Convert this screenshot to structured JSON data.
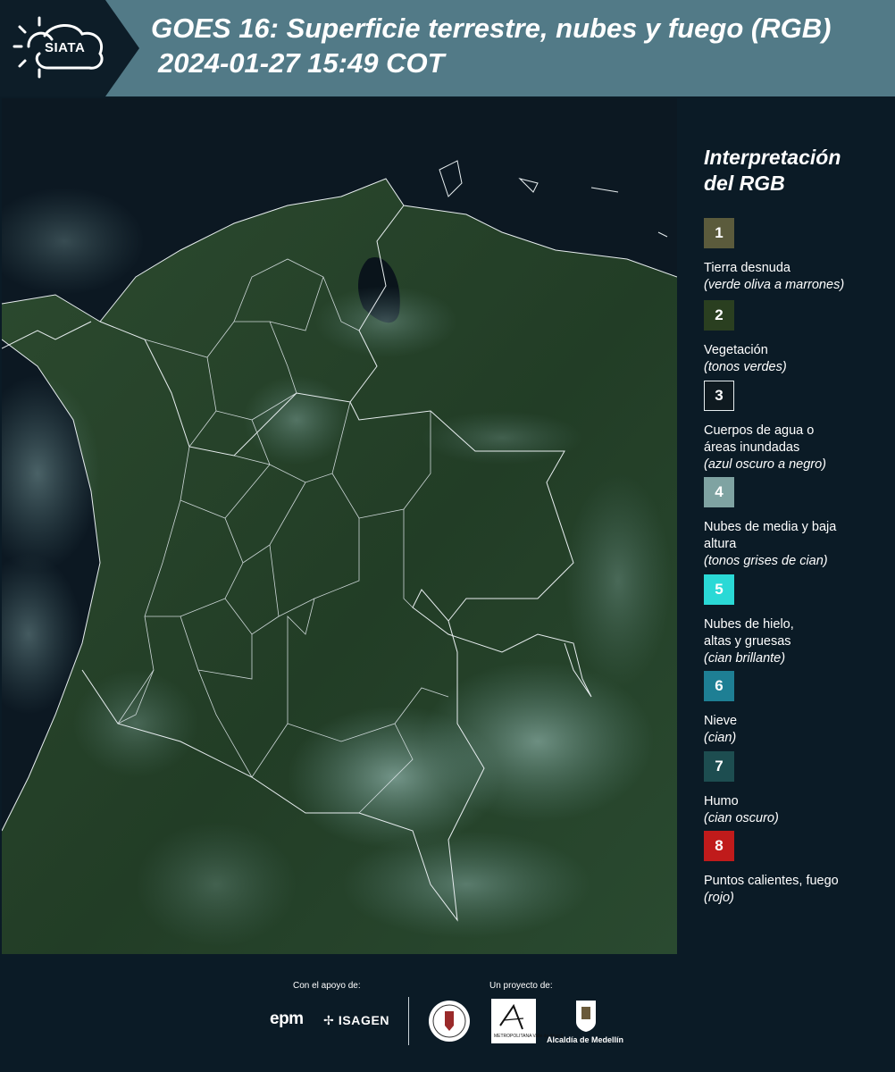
{
  "header": {
    "logo_text": "SIATA",
    "title_line1": "GOES 16: Superficie terrestre, nubes y fuego (RGB)",
    "title_line2": "2024-01-27 15:49 COT"
  },
  "legend": {
    "title_line1": "Interpretación",
    "title_line2": "del RGB",
    "items": [
      {
        "num": "1",
        "color": "#5b5b3c",
        "label": "Tierra desnuda",
        "sub": "(verde oliva a marrones)"
      },
      {
        "num": "2",
        "color": "#2a3f20",
        "label": "Vegetación",
        "sub": "(tonos verdes)"
      },
      {
        "num": "3",
        "color": "#0f1a20",
        "label": "Cuerpos de agua o áreas inundadas",
        "sub": "(azul oscuro a negro)"
      },
      {
        "num": "4",
        "color": "#7fa3a2",
        "label": "Nubes de media y baja altura",
        "sub": "(tonos grises de cian)"
      },
      {
        "num": "5",
        "color": "#2ad9d6",
        "label": "Nubes de hielo, altas y gruesas",
        "sub": "(cian brillante)"
      },
      {
        "num": "6",
        "color": "#1e7f94",
        "label": "Nieve",
        "sub": "(cian)"
      },
      {
        "num": "7",
        "color": "#1d4d50",
        "label": "Humo",
        "sub": "(cian oscuro)"
      },
      {
        "num": "8",
        "color": "#c01b1b",
        "label": "Puntos calientes, fuego",
        "sub": "(rojo)"
      }
    ]
  },
  "footer": {
    "support_label": "Con el apoyo de:",
    "project_label": "Un proyecto de:",
    "epm": "epm",
    "isagen": "ISAGEN",
    "area_text": "METROPOLITANA Valle de Aburrá",
    "medellin": "Alcaldía de Medellín"
  }
}
